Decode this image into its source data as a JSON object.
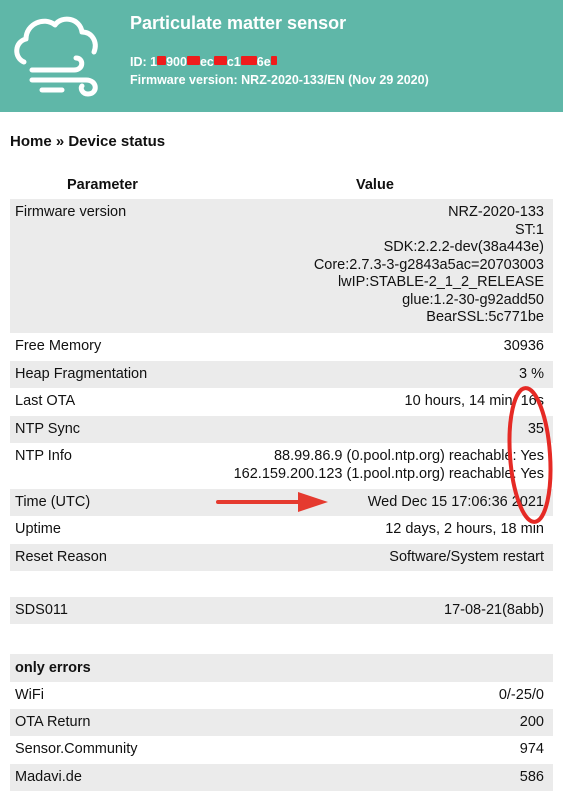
{
  "header": {
    "title": "Particulate matter sensor",
    "id_prefix": "ID: 1",
    "id_visible_parts": [
      "900",
      "ec",
      "c1",
      "6e"
    ],
    "firmware_line": "Firmware version: NRZ-2020-133/EN (Nov 29 2020)",
    "logo_icon": "cloud-wind-icon",
    "background_color": "#5fb7a8",
    "redaction_color": "#ee1c1c"
  },
  "breadcrumb": "Home » Device status",
  "table": {
    "headers": [
      "Parameter",
      "Value"
    ],
    "rows": [
      {
        "label": "Firmware version",
        "values": [
          "NRZ-2020-133",
          "ST:1",
          "SDK:2.2.2-dev(38a443e)",
          "Core:2.7.3-3-g2843a5ac=20703003",
          "lwIP:STABLE-2_1_2_RELEASE",
          "glue:1.2-30-g92add50",
          "BearSSL:5c771be"
        ]
      },
      {
        "label": "Free Memory",
        "values": [
          "30936"
        ]
      },
      {
        "label": "Heap Fragmentation",
        "values": [
          "3 %"
        ]
      },
      {
        "label": "Last OTA",
        "values": [
          "10 hours, 14 min, 16s"
        ]
      },
      {
        "label": "NTP Sync",
        "values": [
          "35"
        ]
      },
      {
        "label": "NTP Info",
        "values": [
          "88.99.86.9 (0.pool.ntp.org) reachable: Yes",
          "162.159.200.123 (1.pool.ntp.org) reachable: Yes"
        ]
      },
      {
        "label": "Time (UTC)",
        "values": [
          "Wed Dec 15 17:06:36 2021"
        ]
      },
      {
        "label": "Uptime",
        "values": [
          "12 days, 2 hours, 18 min"
        ]
      },
      {
        "label": "Reset Reason",
        "values": [
          "Software/System restart"
        ]
      }
    ],
    "sensor_row": {
      "label": "SDS011",
      "value": "17-08-21(8abb)"
    },
    "errors_section": {
      "title": "only errors",
      "rows": [
        {
          "label": "WiFi",
          "value": "0/-25/0"
        },
        {
          "label": "OTA Return",
          "value": "200"
        },
        {
          "label": "Sensor.Community",
          "value": "974"
        },
        {
          "label": "Madavi.de",
          "value": "586"
        }
      ]
    }
  },
  "annotations": {
    "arrow_color": "#e53a2f",
    "ellipse_color": "#e52a25"
  }
}
